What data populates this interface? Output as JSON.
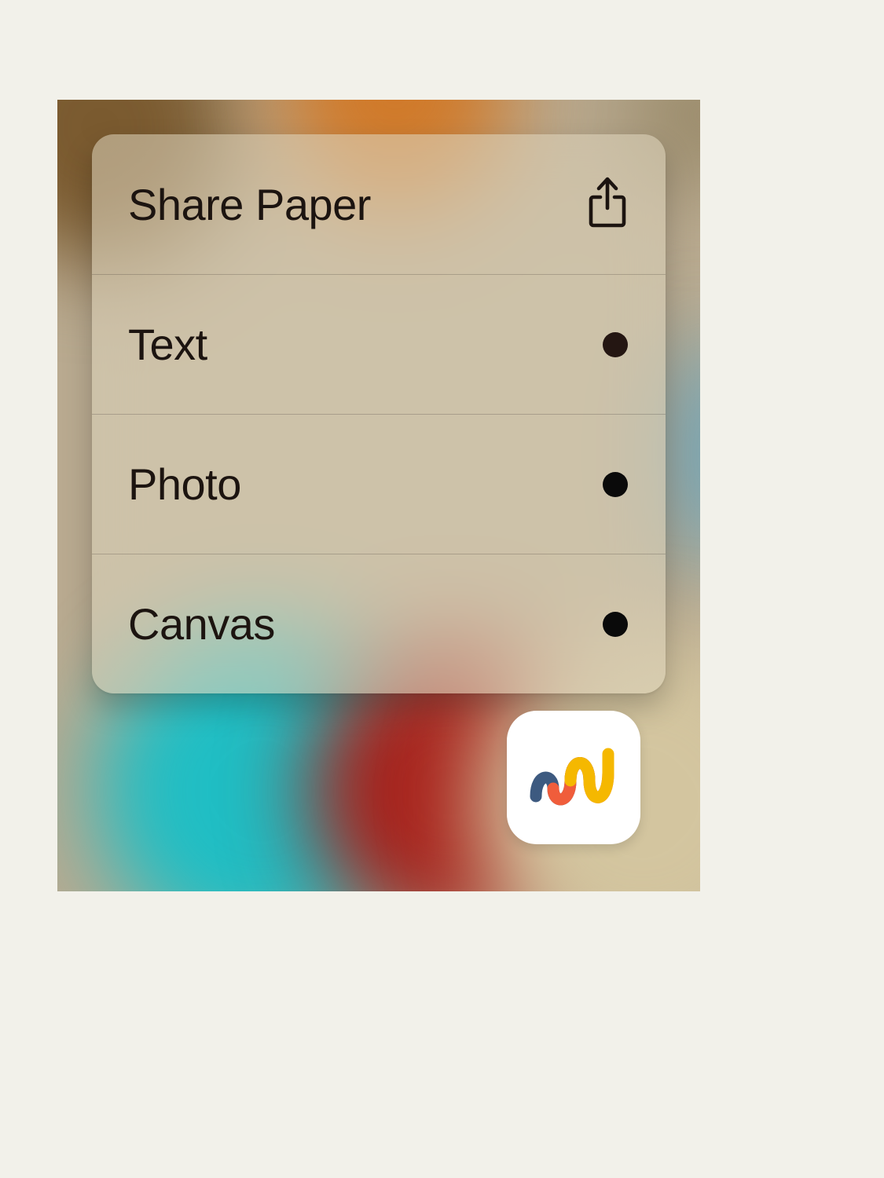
{
  "quick_actions": {
    "items": [
      {
        "label": "Share Paper",
        "icon": "share-icon"
      },
      {
        "label": "Text",
        "icon": "dot-dark"
      },
      {
        "label": "Photo",
        "icon": "dot-black"
      },
      {
        "label": "Canvas",
        "icon": "dot-black"
      }
    ]
  },
  "app": {
    "name": "Paper"
  }
}
